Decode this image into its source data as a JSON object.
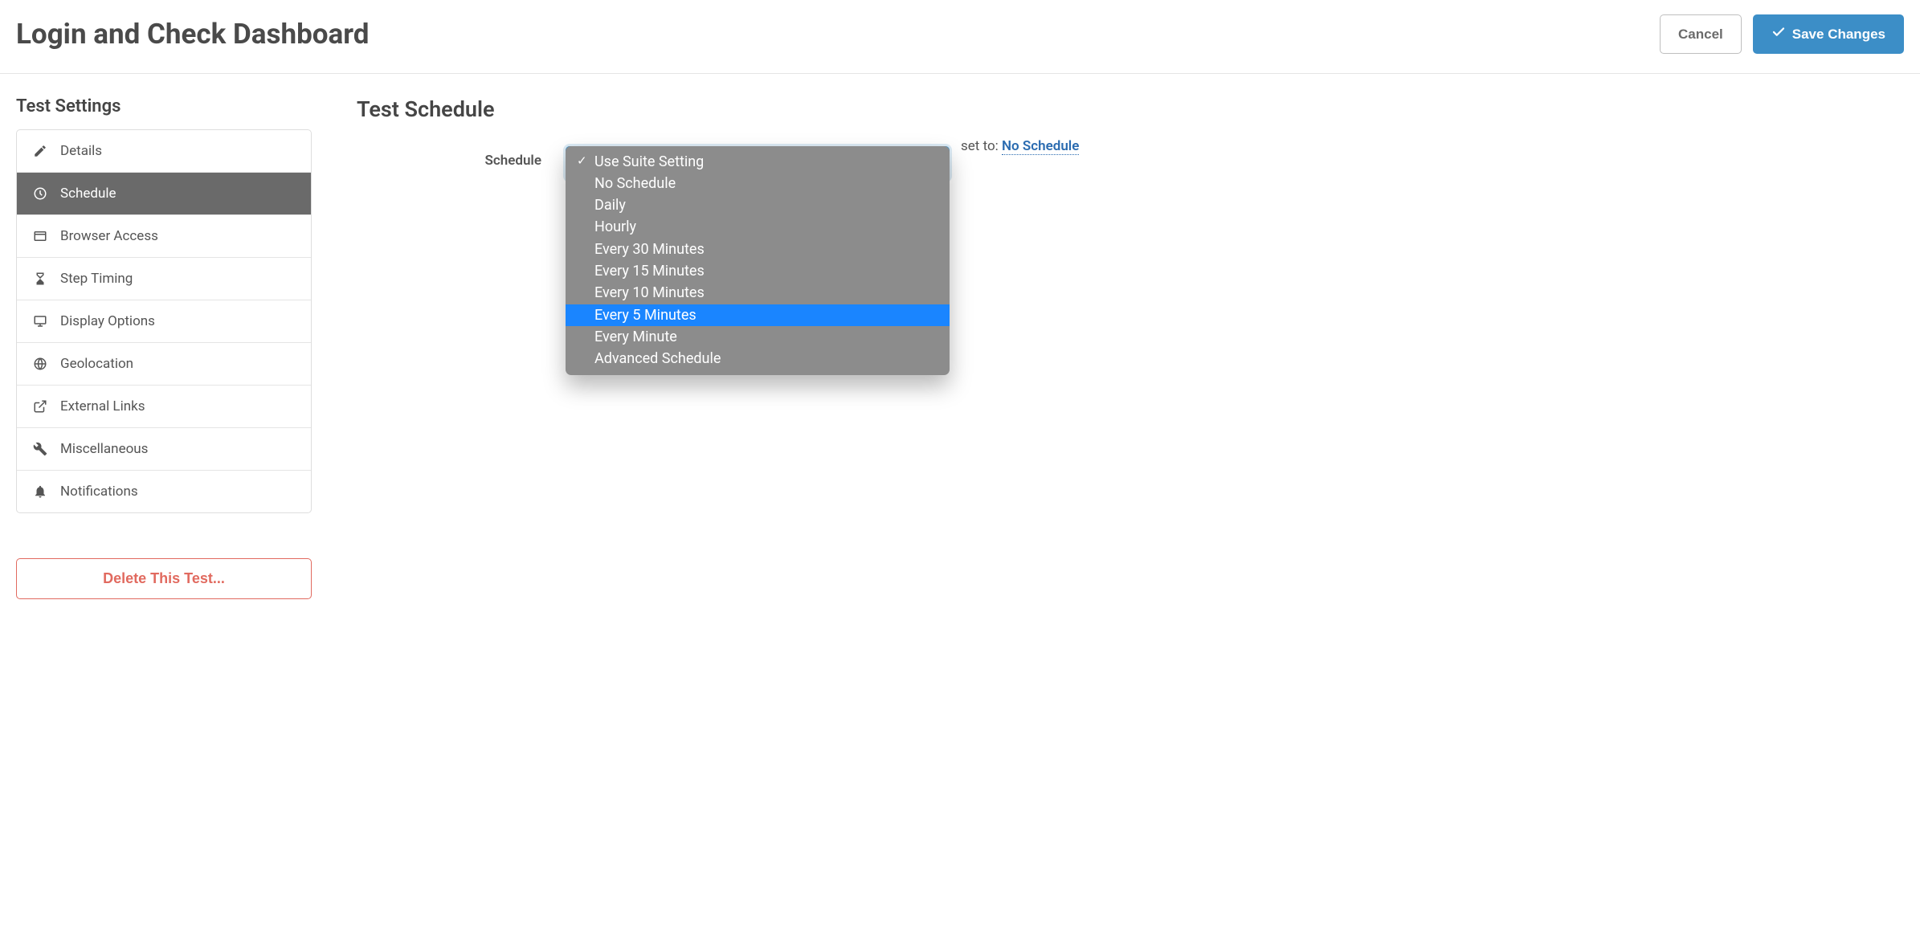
{
  "header": {
    "title": "Login and Check Dashboard",
    "cancel": "Cancel",
    "save": "Save Changes"
  },
  "sidebar": {
    "title": "Test Settings",
    "items": [
      {
        "label": "Details",
        "icon": "pencil",
        "active": false
      },
      {
        "label": "Schedule",
        "icon": "clock",
        "active": true
      },
      {
        "label": "Browser Access",
        "icon": "window",
        "active": false
      },
      {
        "label": "Step Timing",
        "icon": "hourglass",
        "active": false
      },
      {
        "label": "Display Options",
        "icon": "monitor",
        "active": false
      },
      {
        "label": "Geolocation",
        "icon": "globe",
        "active": false
      },
      {
        "label": "External Links",
        "icon": "external",
        "active": false
      },
      {
        "label": "Miscellaneous",
        "icon": "wrench",
        "active": false
      },
      {
        "label": "Notifications",
        "icon": "bell",
        "active": false
      }
    ],
    "delete": "Delete This Test..."
  },
  "main": {
    "title": "Test Schedule",
    "schedule_label": "Schedule",
    "info_prefix": "set to:",
    "info_link": "No Schedule",
    "dropdown": {
      "options": [
        "Use Suite Setting",
        "No Schedule",
        "Daily",
        "Hourly",
        "Every 30 Minutes",
        "Every 15 Minutes",
        "Every 10 Minutes",
        "Every 5 Minutes",
        "Every Minute",
        "Advanced Schedule"
      ],
      "checked_index": 0,
      "highlighted_index": 7
    }
  }
}
